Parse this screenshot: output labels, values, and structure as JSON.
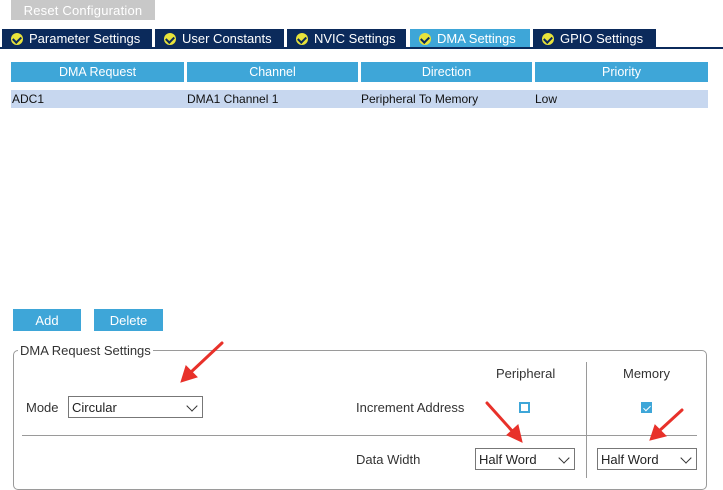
{
  "toolbar": {
    "reset_label": "Reset Configuration"
  },
  "tabs": [
    {
      "label": "Parameter Settings",
      "active": false
    },
    {
      "label": "User Constants",
      "active": false
    },
    {
      "label": "NVIC Settings",
      "active": false
    },
    {
      "label": "DMA Settings",
      "active": true
    },
    {
      "label": "GPIO Settings",
      "active": false
    }
  ],
  "table": {
    "headers": [
      "DMA Request",
      "Channel",
      "Direction",
      "Priority"
    ],
    "rows": [
      {
        "request": "ADC1",
        "channel": "DMA1 Channel 1",
        "direction": "Peripheral To Memory",
        "priority": "Low"
      }
    ]
  },
  "actions": {
    "add_label": "Add",
    "delete_label": "Delete"
  },
  "settings": {
    "title": "DMA Request Settings",
    "mode_label": "Mode",
    "mode_value": "Circular",
    "peripheral_header": "Peripheral",
    "memory_header": "Memory",
    "increment_label": "Increment Address",
    "peripheral_increment": false,
    "memory_increment": true,
    "data_width_label": "Data Width",
    "peripheral_width": "Half Word",
    "memory_width": "Half Word"
  },
  "colors": {
    "tab_bg": "#0b2a5b",
    "accent": "#3ea6d8",
    "row_selected": "#c7d7ef",
    "check_badge": "#e8e33b",
    "annotation_arrow": "#e8312a"
  }
}
